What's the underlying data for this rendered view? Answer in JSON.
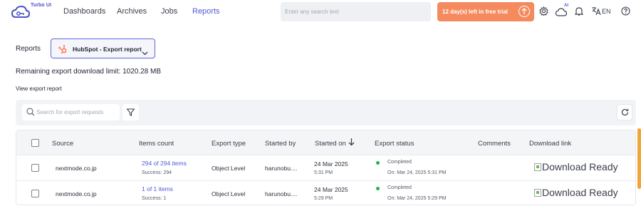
{
  "app": {
    "logo_text": "Turbo UI"
  },
  "nav": {
    "items": [
      {
        "label": "Dashboards",
        "active": false
      },
      {
        "label": "Archives",
        "active": false
      },
      {
        "label": "Jobs",
        "active": false
      },
      {
        "label": "Reports",
        "active": true
      }
    ]
  },
  "topbar": {
    "search_placeholder": "Enter any search text",
    "trial_label": "12 day(s) left in free trial",
    "ai_badge": "AI",
    "language": "EN",
    "icons": [
      "settings-icon",
      "cloud-ai-icon",
      "bell-icon",
      "translate-icon",
      "help-icon"
    ]
  },
  "page": {
    "reports_label": "Reports",
    "report_selector": "HubSpot - Export report",
    "limit_text": "Remaining export download limit: 1020.28 MB",
    "view_report_label": "View export report"
  },
  "toolbar": {
    "search_placeholder": "Search for export requests"
  },
  "table": {
    "columns": [
      "Source",
      "Items count",
      "Export type",
      "Started by",
      "Started on",
      "Export status",
      "Comments",
      "Download link"
    ],
    "sort_column": "Started on",
    "sort_direction": "descending",
    "rows": [
      {
        "source": "nextmode.co.jp",
        "items_link": "294 of 294 items",
        "success": "Success: 294",
        "export_type": "Object Level",
        "started_by": "harunobu....",
        "date": "24 Mar 2025",
        "time": "5:31 PM",
        "status": "Completed",
        "status_on": "On: Mar 24, 2025 5:31 PM",
        "comments": "",
        "download": "Download Ready"
      },
      {
        "source": "nextmode.co.jp",
        "items_link": "1 of 1 items",
        "success": "Success: 1",
        "export_type": "Object Level",
        "started_by": "harunobu....",
        "date": "24 Mar 2025",
        "time": "5:29 PM",
        "status": "Completed",
        "status_on": "On: Mar 24, 2025 5:29 PM",
        "comments": "",
        "download": "Download Ready"
      }
    ]
  },
  "colors": {
    "accent": "#4f5bd5",
    "trial": "#f58a5e",
    "status_completed": "#22b24c",
    "hubspot": "#ff7a59"
  }
}
